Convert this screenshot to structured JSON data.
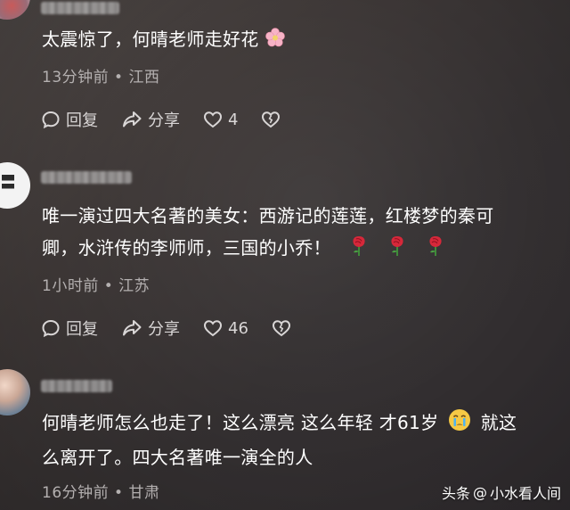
{
  "comments": [
    {
      "text": "太震惊了，何晴老师走好花",
      "time": "13分钟前",
      "location": "江西",
      "reply_label": "回复",
      "share_label": "分享",
      "like_count": "4",
      "emoji": "cherry-blossom-emoji"
    },
    {
      "text_line1": "唯一演过四大名著的美女：西游记的莲莲，红楼梦的秦可",
      "text_line2": "卿，水浒传的李师师，三国的小乔！",
      "time": "1小时前",
      "location": "江苏",
      "reply_label": "回复",
      "share_label": "分享",
      "like_count": "46",
      "emoji": "rose-emoji"
    },
    {
      "text_line1a": "何晴老师怎么也走了！这么漂亮 这么年轻 才61岁",
      "text_line1b": "就这",
      "text_line2": "么离开了。四大名著唯一演全的人",
      "time": "16分钟前",
      "location": "甘肃",
      "emoji": "crying-face-emoji"
    }
  ],
  "separator": "•",
  "watermark": {
    "brand": "头条",
    "at": "@",
    "account": "小水看人间"
  },
  "colors": {
    "text": "#ffffff",
    "meta": "#b4b0b0",
    "action": "#d9d6d6",
    "background": "#3d3736"
  }
}
